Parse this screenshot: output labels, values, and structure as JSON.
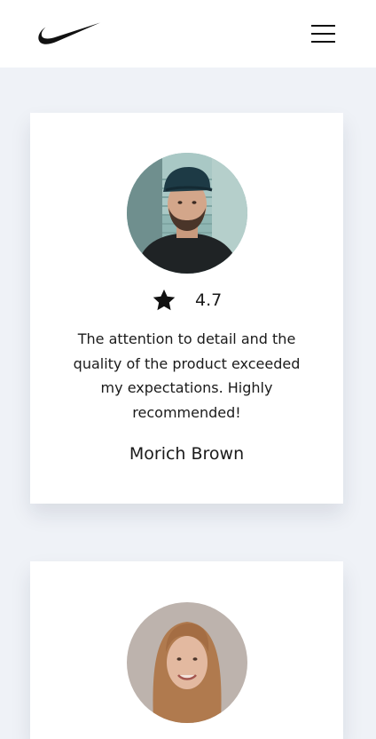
{
  "header": {
    "logo_icon": "swoosh-logo-icon",
    "menu_icon": "hamburger-menu-icon"
  },
  "testimonials": [
    {
      "avatar_icon": "avatar-photo-man",
      "rating_icon": "star-icon",
      "rating": "4.7",
      "quote": "The attention to detail and the quality of the product exceeded my expectations. Highly recommended!",
      "author": "Morich Brown"
    },
    {
      "avatar_icon": "avatar-photo-woman"
    }
  ],
  "colors": {
    "page_background": "#eff2f7",
    "card_background": "#ffffff",
    "text": "#1a1a1a"
  }
}
